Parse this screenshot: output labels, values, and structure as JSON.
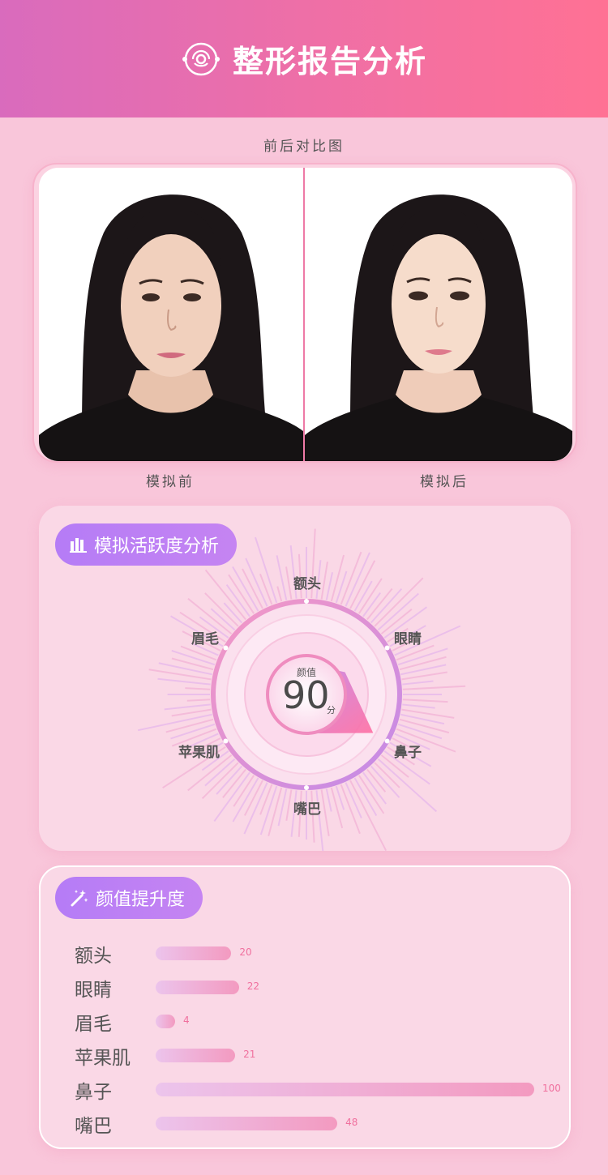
{
  "header": {
    "title": "整形报告分析",
    "icon": "face-scan-icon"
  },
  "compare": {
    "caption": "前后对比图",
    "before_label": "模拟前",
    "after_label": "模拟后"
  },
  "activity": {
    "title": "模拟活跃度分析",
    "score_label": "颜值",
    "score": "90",
    "score_unit": "分",
    "axes": [
      "额头",
      "眼睛",
      "鼻子",
      "嘴巴",
      "苹果肌",
      "眉毛"
    ],
    "values": [
      0.38,
      0.55,
      0.95,
      0.48,
      0.45,
      0.3
    ]
  },
  "boost": {
    "title": "颜值提升度",
    "max": 100,
    "items": [
      {
        "name": "额头",
        "value": 20
      },
      {
        "name": "眼睛",
        "value": 22
      },
      {
        "name": "眉毛",
        "value": 4
      },
      {
        "name": "苹果肌",
        "value": 21
      },
      {
        "name": "鼻子",
        "value": 100
      },
      {
        "name": "嘴巴",
        "value": 48
      }
    ]
  },
  "colors": {
    "accent_pink": "#ff7194",
    "accent_purple": "#b57cf6",
    "bar_end": "#f39ac0"
  }
}
